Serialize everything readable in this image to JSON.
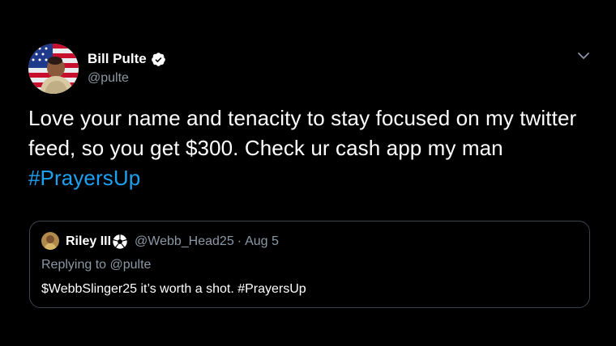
{
  "colors": {
    "background": "#000000",
    "text_primary": "#ffffff",
    "text_secondary": "#8b98a5",
    "link": "#1da1f2",
    "border": "#3d4449"
  },
  "tweet": {
    "author": {
      "name": "Bill Pulte",
      "handle": "@pulte",
      "verified_icon": "verified-badge-icon",
      "avatar_icon": "american-flag-avatar"
    },
    "menu_icon": "chevron-down-icon",
    "text_part1": "Love your name and tenacity to stay focused on my twitter feed, so you get $300. Check ur cash app my man ",
    "hashtag": "#PrayersUp",
    "quoted": {
      "name": "Riley III",
      "emoji_icon": "soccer-ball-icon",
      "handle": "@Webb_Head25",
      "separator": "·",
      "date": "Aug 5",
      "replying_prefix": "Replying to ",
      "replying_to": "@pulte",
      "text": "$WebbSlinger25 it’s worth a shot. #PrayersUp"
    }
  }
}
